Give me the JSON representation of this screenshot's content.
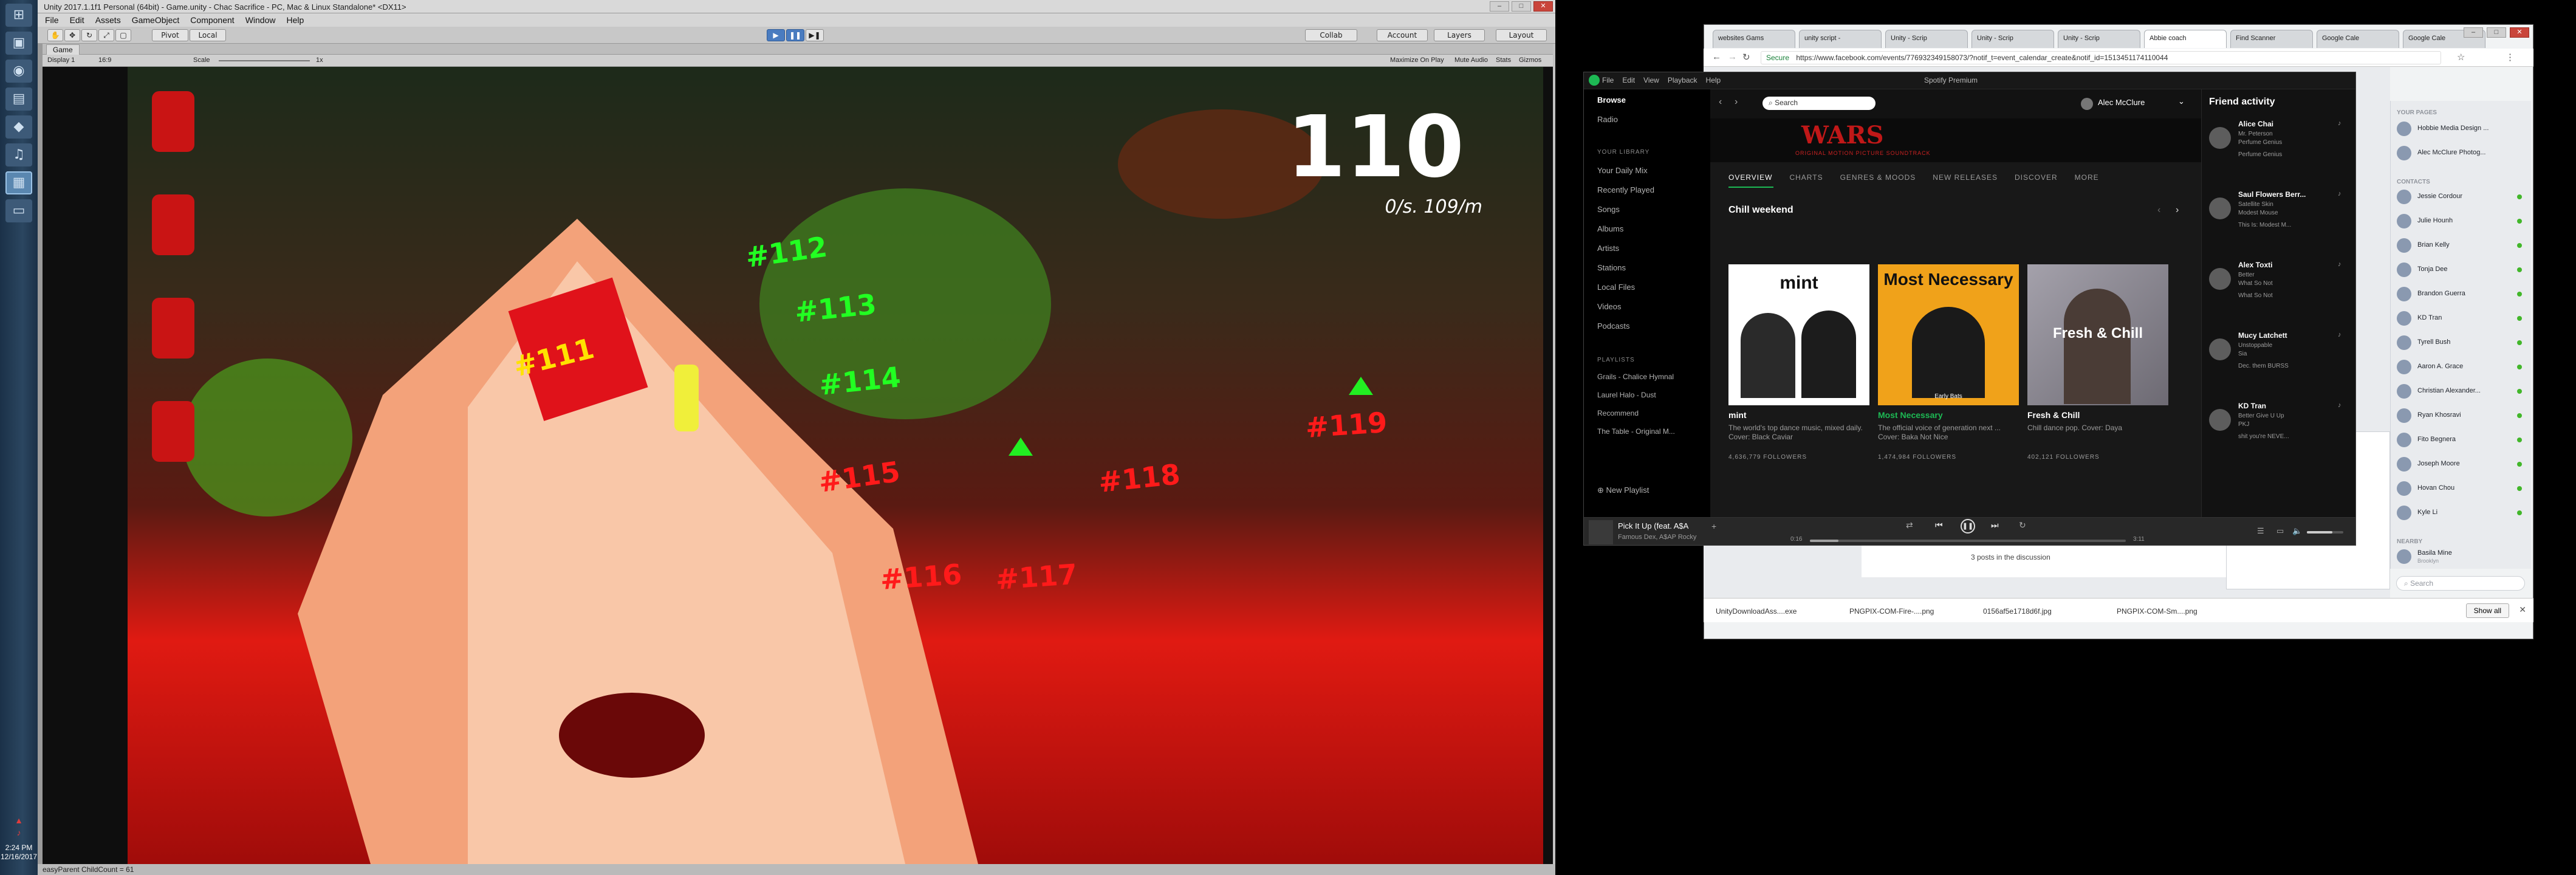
{
  "taskbar": {
    "clock": {
      "time": "2:24 PM",
      "date": "12/16/2017"
    }
  },
  "unity": {
    "title": "Unity 2017.1.1f1 Personal (64bit) - Game.unity - Chac Sacrifice - PC, Mac & Linux Standalone* <DX11>",
    "menu": [
      "File",
      "Edit",
      "Assets",
      "GameObject",
      "Component",
      "Window",
      "Help"
    ],
    "toolbar": {
      "pivot": "Pivot",
      "local": "Local",
      "collab": "Collab",
      "account": "Account",
      "layers": "Layers",
      "layout": "Layout"
    },
    "game_tab": "Game",
    "display": "Display 1",
    "aspect": "16:9",
    "scale_label": "Scale",
    "scale_value": "1x",
    "game_options": [
      "Maximize On Play",
      "Mute Audio",
      "Stats",
      "Gizmos"
    ],
    "status": "easyParent ChildCount = 61"
  },
  "game": {
    "score": "110",
    "timer": "0/s. 109/m",
    "labels": [
      {
        "text": "#111",
        "c": "#ffe200"
      },
      {
        "text": "#112",
        "c": "#22ff22"
      },
      {
        "text": "#113",
        "c": "#22ff22"
      },
      {
        "text": "#114",
        "c": "#22ff22"
      },
      {
        "text": "#115",
        "c": "#ff1a1a"
      },
      {
        "text": "#116",
        "c": "#ff1a1a"
      },
      {
        "text": "#117",
        "c": "#ff1a1a"
      },
      {
        "text": "#118",
        "c": "#ff1a1a"
      },
      {
        "text": "#119",
        "c": "#ff1a1a"
      }
    ]
  },
  "chrome": {
    "tabs": [
      "websites Gams",
      "unity script -",
      "Unity - Scrip",
      "Unity - Scrip",
      "Unity - Scrip",
      "Abbie coach",
      "Find Scanner",
      "Google Cale",
      "Google Cale"
    ],
    "secure": "Secure",
    "url": "https://www.facebook.com/events/776932349158073/?notif_t=event_calendar_create&notif_id=1513451174110044",
    "downloads": [
      "UnityDownloadAss....exe",
      "PNGPIX-COM-Fire-....png",
      "0156af5e1718d6f.jpg",
      "PNGPIX-COM-Sm....png"
    ],
    "show_all": "Show all",
    "post_text": "3 posts in the discussion"
  },
  "spotify": {
    "title": "Spotify Premium",
    "menu": [
      "File",
      "Edit",
      "View",
      "Playback",
      "Help"
    ],
    "search": "Search",
    "user": "Alec McClure",
    "nav": [
      "Browse",
      "Radio"
    ],
    "library_caption": "YOUR LIBRARY",
    "library": [
      "Your Daily Mix",
      "Recently Played",
      "Songs",
      "Albums",
      "Artists",
      "Stations",
      "Local Files",
      "Videos",
      "Podcasts"
    ],
    "playlists_caption": "PLAYLISTS",
    "playlists": [
      "Grails - Chalice Hymnal",
      "Laurel Halo - Dust",
      "Recommend",
      "The Table - Original M..."
    ],
    "new_playlist": "New Playlist",
    "banner_line1": "WARS",
    "banner_line2": "ORIGINAL MOTION PICTURE SOUNDTRACK",
    "tabs": [
      "OVERVIEW",
      "CHARTS",
      "GENRES & MOODS",
      "NEW RELEASES",
      "DISCOVER",
      "MORE"
    ],
    "section": "Chill weekend",
    "cards": [
      {
        "cover": "mint",
        "title": "mint",
        "desc": "The world's top dance music, mixed daily. Cover: Black Caviar",
        "followers": "4,636,779 FOLLOWERS",
        "title_color": "#ffffff"
      },
      {
        "cover": "Most Necessary",
        "title": "Most Necessary",
        "desc": "The official voice of generation next ... Cover: Baka Not Nice",
        "followers": "1,474,984 FOLLOWERS",
        "title_color": "#1db954"
      },
      {
        "cover": "Fresh & Chill",
        "title": "Fresh & Chill",
        "desc": "Chill dance pop. Cover: Daya",
        "followers": "402,121 FOLLOWERS",
        "title_color": "#ffffff"
      }
    ],
    "cover_small": "Early Bats",
    "friend_activity": "Friend activity",
    "friends": [
      {
        "name": "Alice Chai",
        "l1": "Mr. Peterson",
        "l2": "Perfume Genius",
        "l3": "Perfume Genius"
      },
      {
        "name": "Saul Flowers Berr...",
        "l1": "Satellite Skin",
        "l2": "Modest Mouse",
        "l3": "This Is: Modest M..."
      },
      {
        "name": "Alex Toxti",
        "l1": "Better",
        "l2": "What So Not",
        "l3": "What So Not"
      },
      {
        "name": "Mucy Latchett",
        "l1": "Unstoppable",
        "l2": "Sia",
        "l3": "Dec. them BURSS"
      },
      {
        "name": "KD Tran",
        "l1": "Better Give U Up",
        "l2": "PKJ",
        "l3": "shit you're NEVE..."
      }
    ],
    "now_playing": {
      "title": "Pick It Up (feat. A$A",
      "artist": "Famous Dex, A$AP Rocky",
      "elapsed": "0:16",
      "total": "3:11",
      "progress": 0.09,
      "volume": 0.7
    }
  },
  "facebook": {
    "your_pages": "YOUR PAGES",
    "pages": [
      "Hobbie Media Design ...",
      "Alec McClure Photog..."
    ],
    "contacts_caption": "CONTACTS",
    "contacts": [
      "Jessie Cordour",
      "Julie Hounh",
      "Brian Kelly",
      "Tonja Dee",
      "Brandon Guerra",
      "KD Tran",
      "Tyrell Bush",
      "Aaron A. Grace",
      "Christian Alexander...",
      "Ryan Khosravi",
      "Fito Begnera",
      "Joseph Moore",
      "Hovan Chou",
      "Kyle Li"
    ],
    "nearby": "NEARBY",
    "nearby_item": "Basila Mine",
    "nearby_sub": "Brooklyn",
    "search": "Search"
  }
}
